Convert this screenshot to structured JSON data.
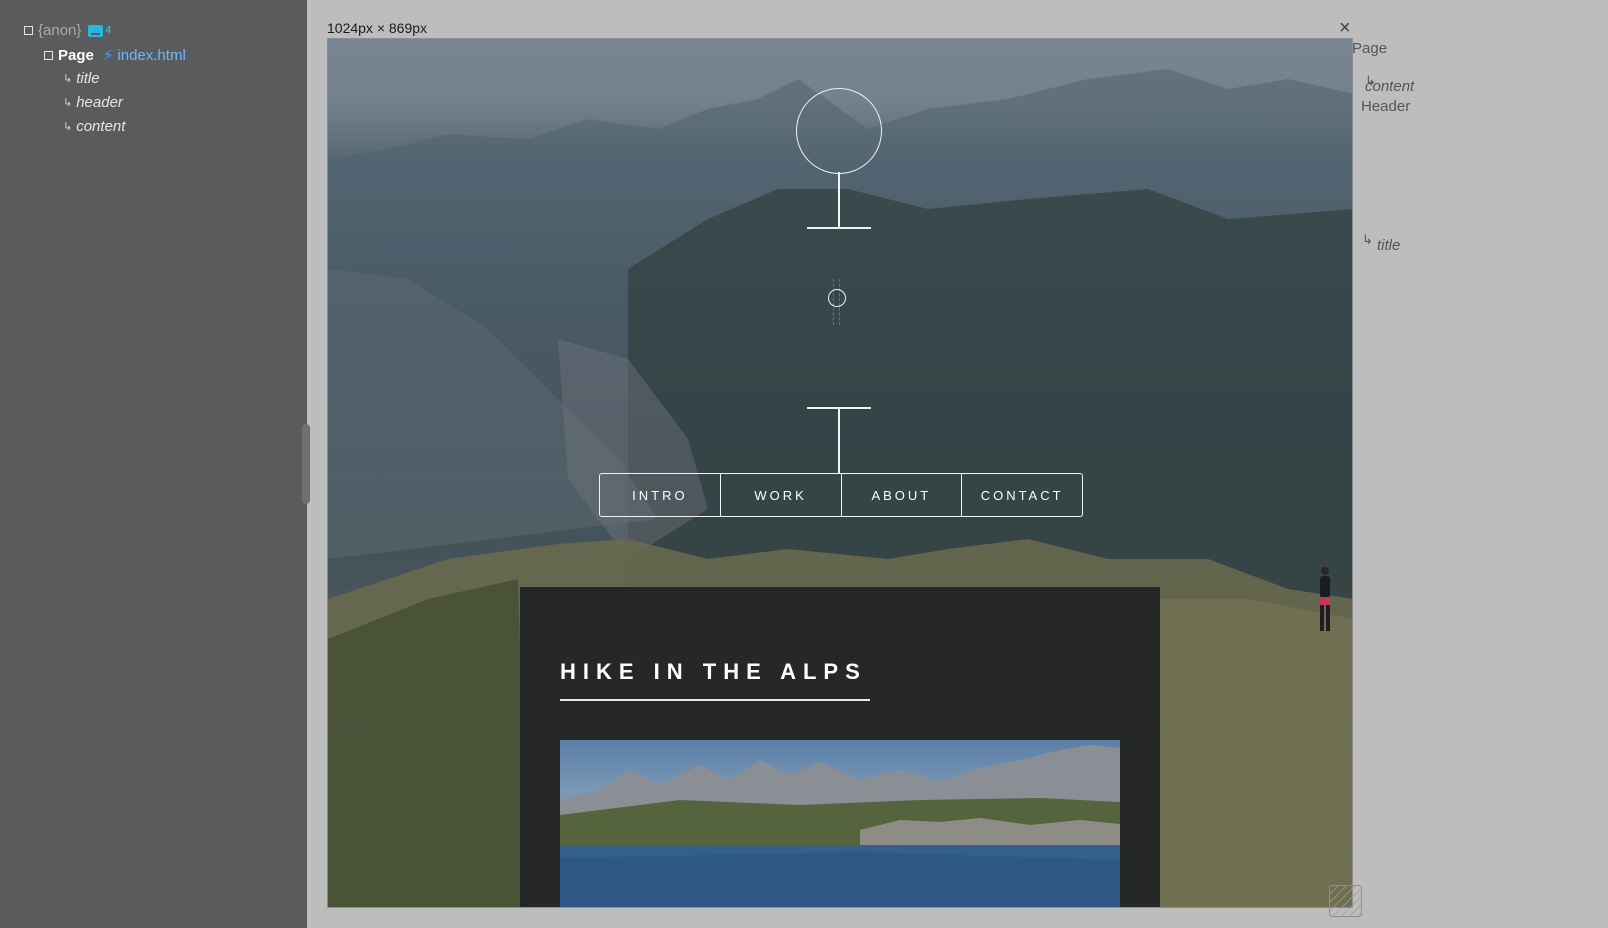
{
  "tree": {
    "anon_label": "{anon}",
    "anon_icon": "component-icon",
    "anon_count": "4",
    "page_label": "Page",
    "page_file": "index.html",
    "children": [
      "title",
      "header",
      "content"
    ]
  },
  "preview": {
    "dimensions": "1024px × 869px",
    "close_label": "×",
    "nav": [
      "INTRO",
      "WORK",
      "ABOUT",
      "CONTACT"
    ],
    "content_title": "HIKE IN THE ALPS"
  },
  "annotations": {
    "page": "Page",
    "content": "content",
    "header": "Header",
    "title": "title"
  },
  "colors": {
    "sidebar_bg": "#5a5b5c",
    "canvas_bg": "#bdbdbd",
    "link_blue": "#6fb6ff",
    "accent_cyan": "#2bb6e0",
    "selection_blue": "#2f7de0"
  }
}
